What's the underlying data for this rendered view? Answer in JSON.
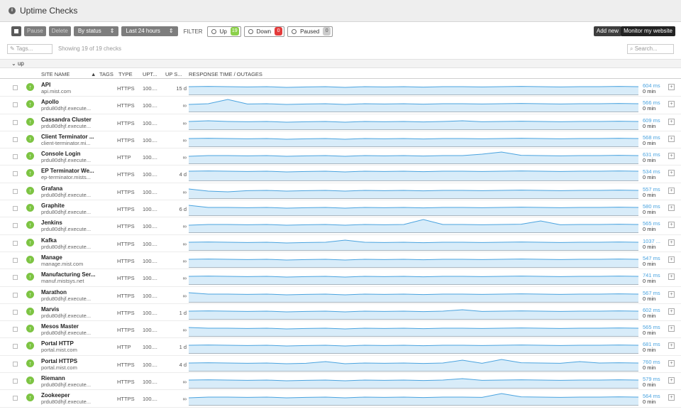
{
  "window": {
    "title": "Uptime Checks"
  },
  "toolbar": {
    "pause_label": "Pause",
    "delete_label": "Delete",
    "status_select": "By status",
    "range_select": "Last 24 hours",
    "filter_label": "FILTER",
    "filters": [
      {
        "label": "Up",
        "count": "19"
      },
      {
        "label": "Down",
        "count": "0"
      },
      {
        "label": "Paused",
        "count": "0"
      }
    ],
    "add_new_label": "Add new",
    "monitor_label": "Monitor my website"
  },
  "search": {
    "tags_placeholder": "Tags...",
    "showing_text": "Showing 19 of 19 checks",
    "search_placeholder": "Search..."
  },
  "group": {
    "label": "up"
  },
  "columns": [
    "SITE NAME",
    "TAGS",
    "TYPE",
    "UPT...",
    "UP S...",
    "RESPONSE TIME / OUTAGES"
  ],
  "colors": {
    "up": "#7dc443",
    "down": "#e33b3b",
    "line": "#4aa3df",
    "area": "#d8ecf9"
  },
  "checks": [
    {
      "name": "API",
      "host": "api.mist.com",
      "type": "HTTPS",
      "uptime": "100....",
      "up_since": "15 d",
      "response": "604 ms",
      "outage": "0 min",
      "series": [
        0.6,
        0.62,
        0.6,
        0.58,
        0.6,
        0.55,
        0.58,
        0.6,
        0.55,
        0.6,
        0.58,
        0.6,
        0.57,
        0.6,
        0.6,
        0.58,
        0.6,
        0.62,
        0.6,
        0.58,
        0.6,
        0.6,
        0.62,
        0.6
      ]
    },
    {
      "name": "Apollo",
      "host": "prdu80dhjf.execute...",
      "type": "HTTPS",
      "uptime": "100....",
      "up_since": "∞",
      "response": "566 ms",
      "outage": "0 min",
      "series": [
        0.55,
        0.6,
        0.9,
        0.58,
        0.6,
        0.55,
        0.58,
        0.6,
        0.55,
        0.6,
        0.58,
        0.6,
        0.57,
        0.6,
        0.6,
        0.58,
        0.6,
        0.62,
        0.6,
        0.58,
        0.6,
        0.6,
        0.62,
        0.6
      ]
    },
    {
      "name": "Cassandra Cluster",
      "host": "prdu80dhjf.execute...",
      "type": "HTTPS",
      "uptime": "100....",
      "up_since": "∞",
      "response": "609 ms",
      "outage": "0 min",
      "series": [
        0.6,
        0.65,
        0.6,
        0.58,
        0.6,
        0.55,
        0.58,
        0.6,
        0.55,
        0.6,
        0.58,
        0.6,
        0.57,
        0.6,
        0.65,
        0.58,
        0.6,
        0.62,
        0.6,
        0.58,
        0.6,
        0.6,
        0.62,
        0.6
      ]
    },
    {
      "name": "Client Terminator ...",
      "host": "client-terminator.mi...",
      "type": "HTTPS",
      "uptime": "100....",
      "up_since": "∞",
      "response": "568 ms",
      "outage": "0 min",
      "series": [
        0.6,
        0.62,
        0.6,
        0.58,
        0.6,
        0.55,
        0.58,
        0.6,
        0.55,
        0.6,
        0.58,
        0.6,
        0.57,
        0.6,
        0.6,
        0.58,
        0.6,
        0.62,
        0.6,
        0.58,
        0.6,
        0.6,
        0.62,
        0.6
      ]
    },
    {
      "name": "Console Login",
      "host": "prdu80dhjf.execute...",
      "type": "HTTP",
      "uptime": "100....",
      "up_since": "∞",
      "response": "631 ms",
      "outage": "0 min",
      "series": [
        0.55,
        0.6,
        0.6,
        0.58,
        0.6,
        0.55,
        0.58,
        0.6,
        0.55,
        0.6,
        0.58,
        0.6,
        0.57,
        0.6,
        0.6,
        0.7,
        0.85,
        0.62,
        0.6,
        0.58,
        0.6,
        0.6,
        0.62,
        0.6
      ]
    },
    {
      "name": "EP Terminator We...",
      "host": "ep-terminator.mists...",
      "type": "HTTPS",
      "uptime": "100....",
      "up_since": "4 d",
      "response": "534 ms",
      "outage": "0 min",
      "series": [
        0.7,
        0.72,
        0.7,
        0.68,
        0.7,
        0.65,
        0.68,
        0.7,
        0.65,
        0.7,
        0.68,
        0.7,
        0.67,
        0.7,
        0.7,
        0.68,
        0.7,
        0.72,
        0.7,
        0.68,
        0.7,
        0.7,
        0.72,
        0.7
      ]
    },
    {
      "name": "Grafana",
      "host": "prdu80dhjf.execute...",
      "type": "HTTPS",
      "uptime": "100....",
      "up_since": "∞",
      "response": "557 ms",
      "outage": "0 min",
      "series": [
        0.7,
        0.55,
        0.5,
        0.58,
        0.6,
        0.55,
        0.58,
        0.6,
        0.55,
        0.6,
        0.58,
        0.6,
        0.57,
        0.6,
        0.6,
        0.58,
        0.6,
        0.62,
        0.6,
        0.58,
        0.6,
        0.6,
        0.62,
        0.6
      ]
    },
    {
      "name": "Graphite",
      "host": "prdu80dhjf.execute...",
      "type": "HTTPS",
      "uptime": "100....",
      "up_since": "6 d",
      "response": "580 ms",
      "outage": "0 min",
      "series": [
        0.75,
        0.6,
        0.6,
        0.58,
        0.6,
        0.55,
        0.58,
        0.6,
        0.55,
        0.6,
        0.58,
        0.6,
        0.57,
        0.6,
        0.6,
        0.58,
        0.6,
        0.62,
        0.6,
        0.58,
        0.6,
        0.6,
        0.62,
        0.6
      ]
    },
    {
      "name": "Jenkins",
      "host": "prdu80dhjf.execute...",
      "type": "HTTPS",
      "uptime": "100....",
      "up_since": "∞",
      "response": "565 ms",
      "outage": "0 min",
      "series": [
        0.55,
        0.6,
        0.6,
        0.58,
        0.6,
        0.55,
        0.58,
        0.6,
        0.55,
        0.6,
        0.58,
        0.6,
        0.95,
        0.6,
        0.6,
        0.58,
        0.6,
        0.62,
        0.85,
        0.58,
        0.6,
        0.6,
        0.62,
        0.6
      ]
    },
    {
      "name": "Kafka",
      "host": "prdu80dhjf.execute...",
      "type": "HTTPS",
      "uptime": "100....",
      "up_since": "∞",
      "response": "1037 ...",
      "outage": "0 min",
      "series": [
        0.6,
        0.62,
        0.6,
        0.58,
        0.6,
        0.55,
        0.58,
        0.6,
        0.75,
        0.6,
        0.58,
        0.6,
        0.57,
        0.6,
        0.6,
        0.58,
        0.6,
        0.62,
        0.6,
        0.58,
        0.6,
        0.6,
        0.62,
        0.6
      ]
    },
    {
      "name": "Manage",
      "host": "manage.mist.com",
      "type": "HTTPS",
      "uptime": "100....",
      "up_since": "∞",
      "response": "547 ms",
      "outage": "0 min",
      "series": [
        0.6,
        0.62,
        0.6,
        0.58,
        0.6,
        0.55,
        0.58,
        0.6,
        0.55,
        0.6,
        0.58,
        0.6,
        0.57,
        0.6,
        0.6,
        0.58,
        0.6,
        0.62,
        0.6,
        0.58,
        0.6,
        0.6,
        0.62,
        0.6
      ]
    },
    {
      "name": "Manufacturing Ser...",
      "host": "manuf.mistsys.net",
      "type": "HTTPS",
      "uptime": "100....",
      "up_since": "∞",
      "response": "741 ms",
      "outage": "0 min",
      "series": [
        0.6,
        0.62,
        0.6,
        0.58,
        0.6,
        0.55,
        0.58,
        0.6,
        0.55,
        0.6,
        0.58,
        0.6,
        0.57,
        0.6,
        0.6,
        0.58,
        0.6,
        0.62,
        0.6,
        0.58,
        0.6,
        0.6,
        0.62,
        0.6
      ]
    },
    {
      "name": "Marathon",
      "host": "prdu80dhjf.execute...",
      "type": "HTTPS",
      "uptime": "100....",
      "up_since": "∞",
      "response": "567 ms",
      "outage": "0 min",
      "series": [
        0.7,
        0.6,
        0.6,
        0.58,
        0.6,
        0.55,
        0.58,
        0.6,
        0.55,
        0.6,
        0.58,
        0.6,
        0.57,
        0.6,
        0.6,
        0.58,
        0.6,
        0.62,
        0.6,
        0.58,
        0.6,
        0.6,
        0.62,
        0.6
      ]
    },
    {
      "name": "Marvis",
      "host": "prdu80dhjf.execute...",
      "type": "HTTPS",
      "uptime": "100....",
      "up_since": "1 d",
      "response": "602 ms",
      "outage": "0 min",
      "series": [
        0.6,
        0.62,
        0.6,
        0.58,
        0.6,
        0.55,
        0.58,
        0.6,
        0.55,
        0.6,
        0.58,
        0.6,
        0.57,
        0.6,
        0.7,
        0.58,
        0.6,
        0.62,
        0.6,
        0.58,
        0.6,
        0.6,
        0.62,
        0.6
      ]
    },
    {
      "name": "Mesos Master",
      "host": "prdu80dhjf.execute...",
      "type": "HTTPS",
      "uptime": "100....",
      "up_since": "∞",
      "response": "565 ms",
      "outage": "0 min",
      "series": [
        0.65,
        0.6,
        0.6,
        0.58,
        0.6,
        0.55,
        0.58,
        0.6,
        0.55,
        0.6,
        0.58,
        0.6,
        0.57,
        0.6,
        0.6,
        0.58,
        0.6,
        0.62,
        0.6,
        0.58,
        0.6,
        0.6,
        0.62,
        0.6
      ]
    },
    {
      "name": "Portal HTTP",
      "host": "portal.mist.com",
      "type": "HTTP",
      "uptime": "100....",
      "up_since": "1 d",
      "response": "681 ms",
      "outage": "0 min",
      "series": [
        0.6,
        0.62,
        0.6,
        0.58,
        0.6,
        0.55,
        0.58,
        0.6,
        0.55,
        0.6,
        0.58,
        0.6,
        0.57,
        0.6,
        0.6,
        0.58,
        0.6,
        0.62,
        0.6,
        0.58,
        0.6,
        0.6,
        0.62,
        0.6
      ]
    },
    {
      "name": "Portal HTTPS",
      "host": "portal.mist.com",
      "type": "HTTPS",
      "uptime": "100....",
      "up_since": "4 d",
      "response": "760 ms",
      "outage": "0 min",
      "series": [
        0.6,
        0.62,
        0.6,
        0.58,
        0.6,
        0.55,
        0.58,
        0.7,
        0.55,
        0.6,
        0.58,
        0.6,
        0.57,
        0.6,
        0.8,
        0.58,
        0.85,
        0.62,
        0.6,
        0.58,
        0.7,
        0.6,
        0.62,
        0.6
      ]
    },
    {
      "name": "Riemann",
      "host": "prdu80dhjf.execute...",
      "type": "HTTPS",
      "uptime": "100....",
      "up_since": "∞",
      "response": "579 ms",
      "outage": "0 min",
      "series": [
        0.6,
        0.62,
        0.6,
        0.58,
        0.6,
        0.55,
        0.58,
        0.6,
        0.55,
        0.6,
        0.58,
        0.6,
        0.57,
        0.6,
        0.7,
        0.58,
        0.6,
        0.62,
        0.6,
        0.58,
        0.6,
        0.6,
        0.62,
        0.6
      ]
    },
    {
      "name": "Zookeeper",
      "host": "prdu80dhjf.execute...",
      "type": "HTTPS",
      "uptime": "100....",
      "up_since": "∞",
      "response": "564 ms",
      "outage": "0 min",
      "series": [
        0.55,
        0.6,
        0.6,
        0.58,
        0.6,
        0.55,
        0.58,
        0.6,
        0.55,
        0.6,
        0.58,
        0.6,
        0.57,
        0.6,
        0.6,
        0.58,
        0.85,
        0.62,
        0.6,
        0.58,
        0.6,
        0.6,
        0.62,
        0.6
      ]
    }
  ]
}
